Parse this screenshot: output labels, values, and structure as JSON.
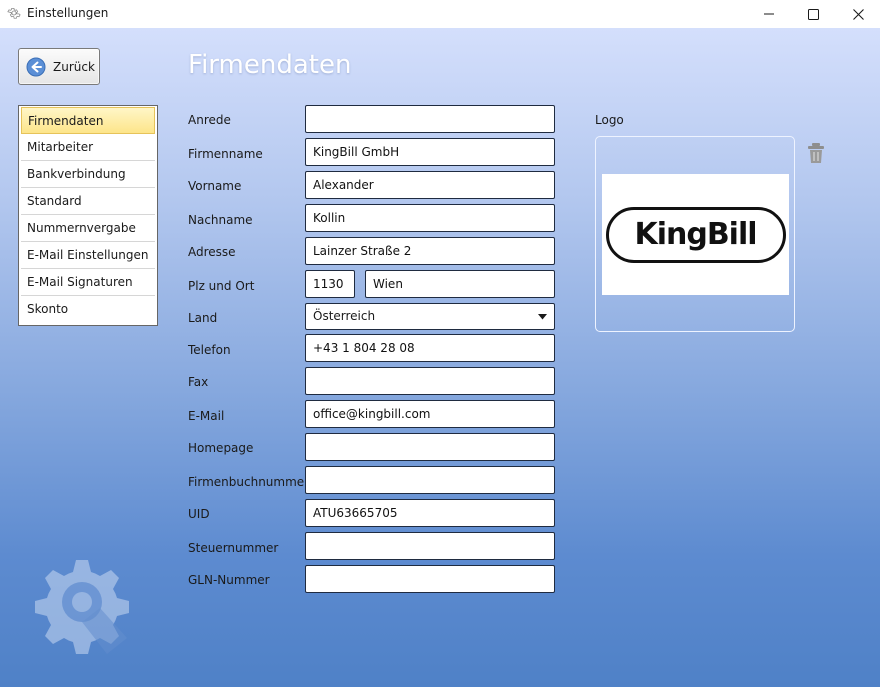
{
  "window": {
    "title": "Einstellungen",
    "icons": {
      "app": "gear-icon",
      "minimize": "minimize-icon",
      "maximize": "maximize-icon",
      "close": "close-icon"
    }
  },
  "back_button": {
    "label": "Zurück",
    "icon": "arrow-left-icon"
  },
  "nav": {
    "items": [
      {
        "label": "Firmendaten",
        "active": true
      },
      {
        "label": "Mitarbeiter"
      },
      {
        "label": "Bankverbindung"
      },
      {
        "label": "Standard"
      },
      {
        "label": "Nummernvergabe"
      },
      {
        "label": "E-Mail Einstellungen"
      },
      {
        "label": "E-Mail Signaturen"
      },
      {
        "label": "Skonto"
      }
    ]
  },
  "page": {
    "title": "Firmendaten"
  },
  "form": {
    "anrede": {
      "label": "Anrede",
      "value": ""
    },
    "firmenname": {
      "label": "Firmenname",
      "value": "KingBill GmbH"
    },
    "vorname": {
      "label": "Vorname",
      "value": "Alexander"
    },
    "nachname": {
      "label": "Nachname",
      "value": "Kollin"
    },
    "adresse": {
      "label": "Adresse",
      "value": "Lainzer Straße 2"
    },
    "plz_ort": {
      "label": "Plz und Ort",
      "plz": "1130",
      "ort": "Wien"
    },
    "land": {
      "label": "Land",
      "value": "Österreich"
    },
    "telefon": {
      "label": "Telefon",
      "value": "+43 1 804 28 08"
    },
    "fax": {
      "label": "Fax",
      "value": ""
    },
    "email": {
      "label": "E-Mail",
      "value": "office@kingbill.com"
    },
    "homepage": {
      "label": "Homepage",
      "value": ""
    },
    "firmenbuchnummer": {
      "label": "Firmenbuchnummer",
      "value": ""
    },
    "uid": {
      "label": "UID",
      "value": "ATU63665705"
    },
    "steuernummer": {
      "label": "Steuernummer",
      "value": ""
    },
    "gln": {
      "label": "GLN-Nummer",
      "value": ""
    }
  },
  "logo": {
    "label": "Logo",
    "brand_text": "KingBill",
    "delete_icon": "trash-icon"
  }
}
